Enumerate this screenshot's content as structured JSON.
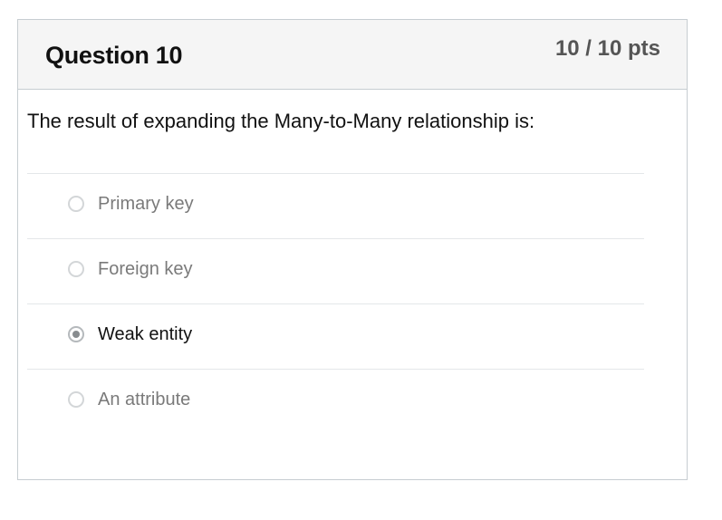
{
  "question": {
    "title": "Question 10",
    "points": "10 / 10 pts",
    "text": "The result of expanding the Many-to-Many relationship is:"
  },
  "answers": [
    {
      "label": "Primary key",
      "selected": false
    },
    {
      "label": "Foreign key",
      "selected": false
    },
    {
      "label": "Weak entity",
      "selected": true
    },
    {
      "label": "An attribute",
      "selected": false
    }
  ],
  "colors": {
    "header_bg": "#f5f5f5",
    "border": "#c7cdd1",
    "text_dark": "#111111",
    "text_muted": "#7a7a7a",
    "points": "#555555"
  }
}
